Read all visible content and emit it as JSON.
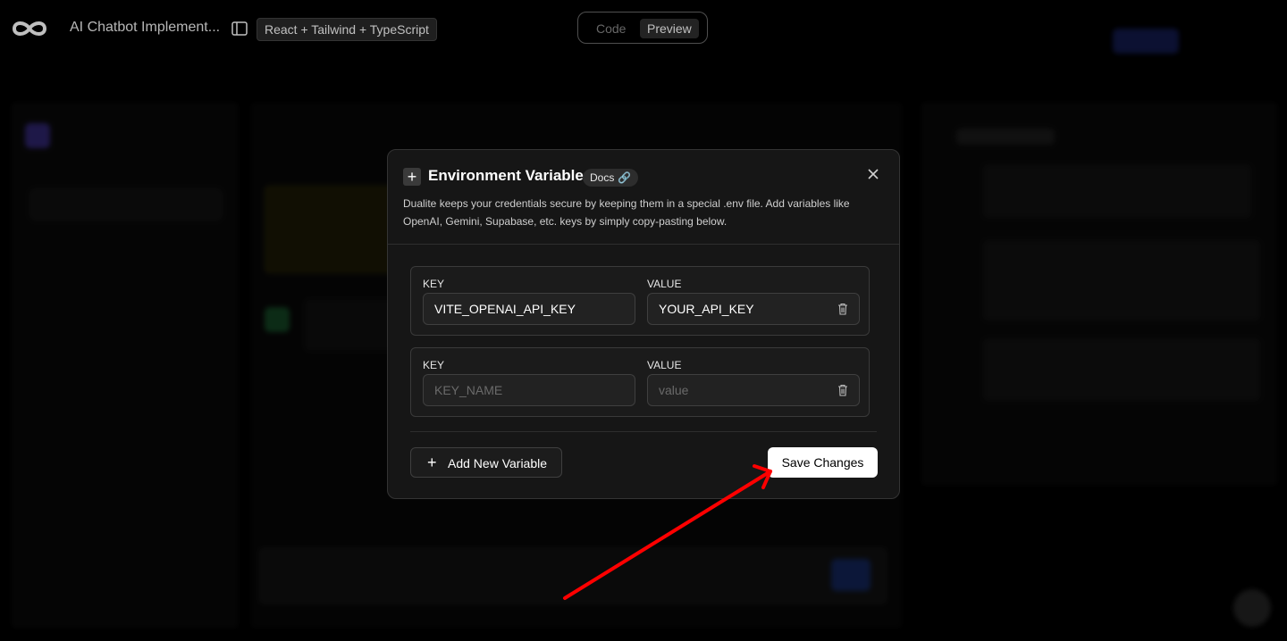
{
  "header": {
    "app_title": "AI Chatbot Implement...",
    "stack_badge": "React + Tailwind + TypeScript",
    "view_tabs": {
      "code": "Code",
      "preview": "Preview",
      "active": "Preview"
    }
  },
  "modal": {
    "title": "Environment Variables",
    "docs_label": "Docs",
    "description": "Dualite keeps your credentials secure by keeping them in a special .env file. Add variables like OpenAI, Gemini, Supabase, etc. keys by simply copy-pasting below.",
    "variables": [
      {
        "key_label": "KEY",
        "value_label": "VALUE",
        "key": "VITE_OPENAI_API_KEY",
        "value": "YOUR_API_KEY"
      },
      {
        "key_label": "KEY",
        "value_label": "VALUE",
        "key": "",
        "value": "",
        "key_placeholder": "KEY_NAME",
        "value_placeholder": "value"
      }
    ],
    "add_button": "Add New Variable",
    "save_button": "Save Changes"
  },
  "colors": {
    "background": "#000000",
    "modal_bg": "#161616",
    "save_button_bg": "#ffffff",
    "annotation_arrow": "#ff0000",
    "docs_link_icon": "#6fa2ff"
  }
}
